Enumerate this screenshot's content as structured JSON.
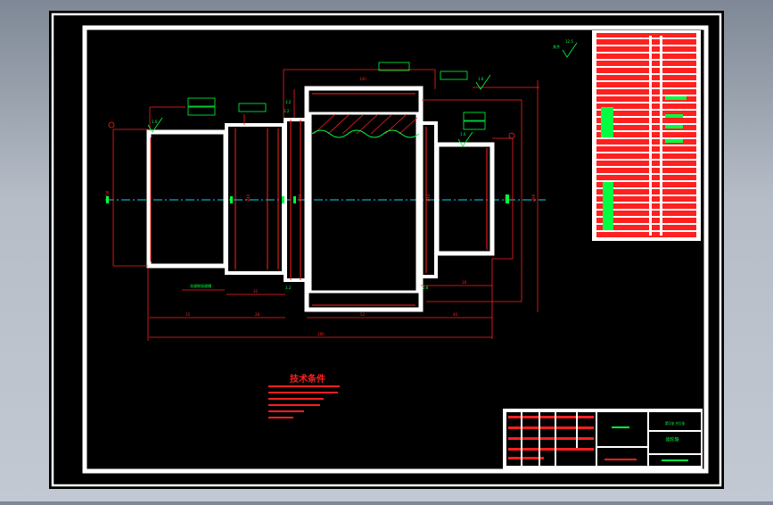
{
  "tech_requirements": {
    "title": "技术条件"
  },
  "title_block": {
    "part_name": "齿轮轴",
    "sheet_note": "第1张 共1张"
  }
}
